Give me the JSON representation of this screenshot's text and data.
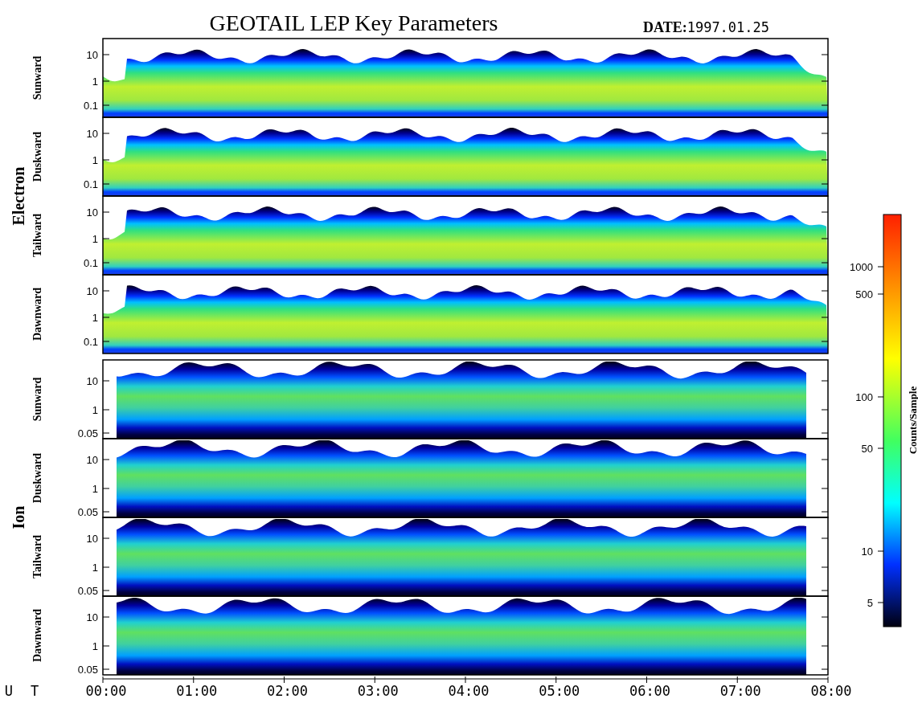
{
  "title": "GEOTAIL LEP Key Parameters",
  "date_label": "DATE:",
  "date_value": "1997.01.25",
  "groups": [
    {
      "label": "Electron",
      "kind": "electron",
      "panels": [
        {
          "label": "Sunward",
          "yticks": [
            "10",
            "1",
            "0.1"
          ]
        },
        {
          "label": "Duskward",
          "yticks": [
            "10",
            "1",
            "0.1"
          ]
        },
        {
          "label": "Tailward",
          "yticks": [
            "10",
            "1",
            "0.1"
          ]
        },
        {
          "label": "Dawnward",
          "yticks": [
            "10",
            "1",
            "0.1"
          ]
        }
      ]
    },
    {
      "label": "Ion",
      "kind": "ion",
      "panels": [
        {
          "label": "Sunward",
          "yticks": [
            "10",
            "1",
            "0.05"
          ]
        },
        {
          "label": "Duskward",
          "yticks": [
            "10",
            "1",
            "0.05"
          ]
        },
        {
          "label": "Tailward",
          "yticks": [
            "10",
            "1",
            "0.05"
          ]
        },
        {
          "label": "Dawnward",
          "yticks": [
            "10",
            "1",
            "0.05"
          ]
        }
      ]
    }
  ],
  "x_axis": {
    "label": "U T",
    "ticks": [
      "00:00",
      "01:00",
      "02:00",
      "03:00",
      "04:00",
      "05:00",
      "06:00",
      "07:00",
      "08:00"
    ]
  },
  "colorbar": {
    "label": "Counts/Sample",
    "ticks": [
      "1000",
      "500",
      "100",
      "50",
      "10",
      "5"
    ]
  }
}
